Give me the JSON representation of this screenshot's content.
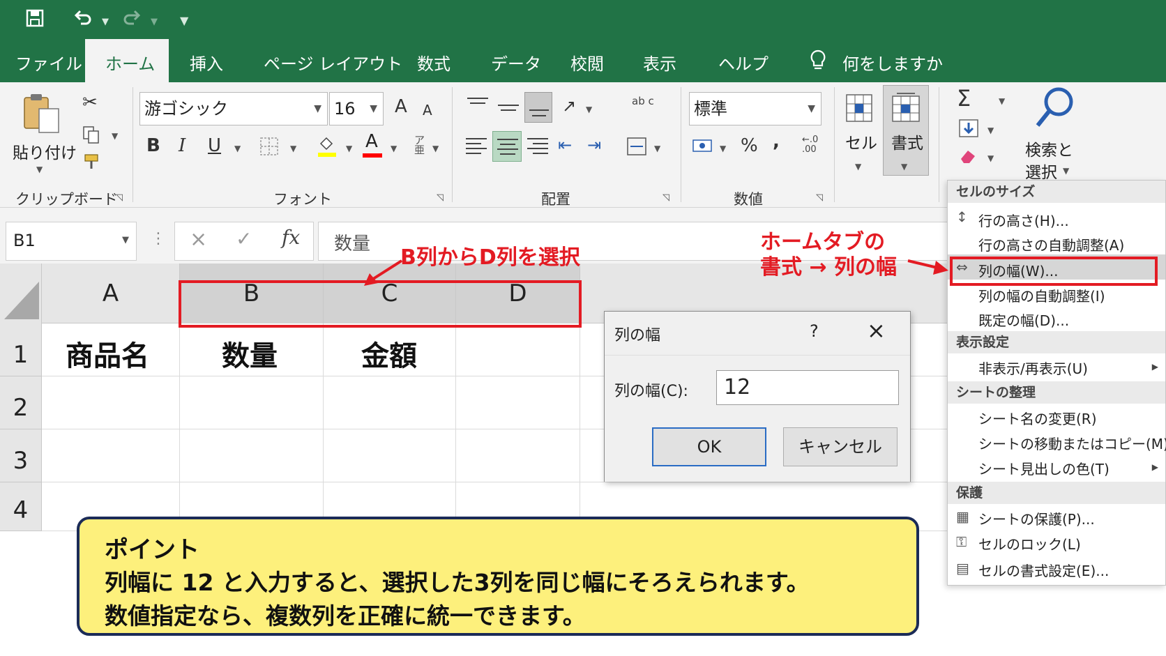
{
  "quick_access": {
    "save_icon": "save-icon",
    "undo_icon": "undo-icon",
    "redo_icon": "redo-icon",
    "customize_icon": "customize-icon"
  },
  "tabs": [
    {
      "label": "ファイル"
    },
    {
      "label": "ホーム"
    },
    {
      "label": "挿入"
    },
    {
      "label": "ページ レイアウト"
    },
    {
      "label": "数式"
    },
    {
      "label": "データ"
    },
    {
      "label": "校閲"
    },
    {
      "label": "表示"
    },
    {
      "label": "ヘルプ"
    }
  ],
  "tell_me": "何をしますか",
  "ribbon": {
    "clipboard": {
      "paste_label": "貼り付け",
      "group_label": "クリップボード"
    },
    "font": {
      "font_name": "游ゴシック",
      "font_size": "16",
      "grow": "A",
      "shrink": "A",
      "bold": "B",
      "italic": "I",
      "underline": "U",
      "font_color_letter": "A",
      "group_label": "フォント",
      "fill_color": "#ffff00",
      "font_color": "#ff0000"
    },
    "alignment": {
      "group_label": "配置",
      "wrap_text": "ab c"
    },
    "number": {
      "format": "標準",
      "percent": "%",
      "comma": ",",
      "group_label": "数値"
    },
    "cells": {
      "cell_label": "セル",
      "format_label": "書式"
    },
    "editing": {
      "sum": "Σ",
      "find_label_1": "検索と",
      "find_label_2": "選択"
    }
  },
  "formula_bar": {
    "name_box": "B1",
    "cancel": "×",
    "enter": "✓",
    "fx": "fx",
    "content": "数量"
  },
  "sheet": {
    "columns": [
      "A",
      "B",
      "C",
      "D"
    ],
    "rows": [
      "1",
      "2",
      "3",
      "4"
    ],
    "cells": {
      "A1": "商品名",
      "B1": "数量",
      "C1": "金額"
    }
  },
  "dialog": {
    "title": "列の幅",
    "help": "?",
    "close": "×",
    "field_label": "列の幅(C):",
    "field_value": "12",
    "ok": "OK",
    "cancel": "キャンセル"
  },
  "format_menu": {
    "cell_size": {
      "header": "セルのサイズ",
      "items": [
        "行の高さ(H)...",
        "行の高さの自動調整(A)",
        "列の幅(W)...",
        "列の幅の自動調整(I)",
        "既定の幅(D)..."
      ]
    },
    "visibility": {
      "header": "表示設定",
      "items": [
        "非表示/再表示(U)"
      ]
    },
    "organize": {
      "header": "シートの整理",
      "items": [
        "シート名の変更(R)",
        "シートの移動またはコピー(M)...",
        "シート見出しの色(T)"
      ]
    },
    "protection": {
      "header": "保護",
      "items": [
        "シートの保護(P)...",
        "セルのロック(L)",
        "セルの書式設定(E)..."
      ]
    }
  },
  "annotations": {
    "select_note": "B列からD列を選択",
    "menu_note_1": "ホームタブの",
    "menu_note_2": "書式 → 列の幅",
    "accent_color": "#e31b23"
  },
  "callout": {
    "title": "ポイント",
    "line1": "列幅に 12 と入力すると、選択した3列を同じ幅にそろえられます。",
    "line2": "数値指定なら、複数列を正確に統一できます。"
  }
}
